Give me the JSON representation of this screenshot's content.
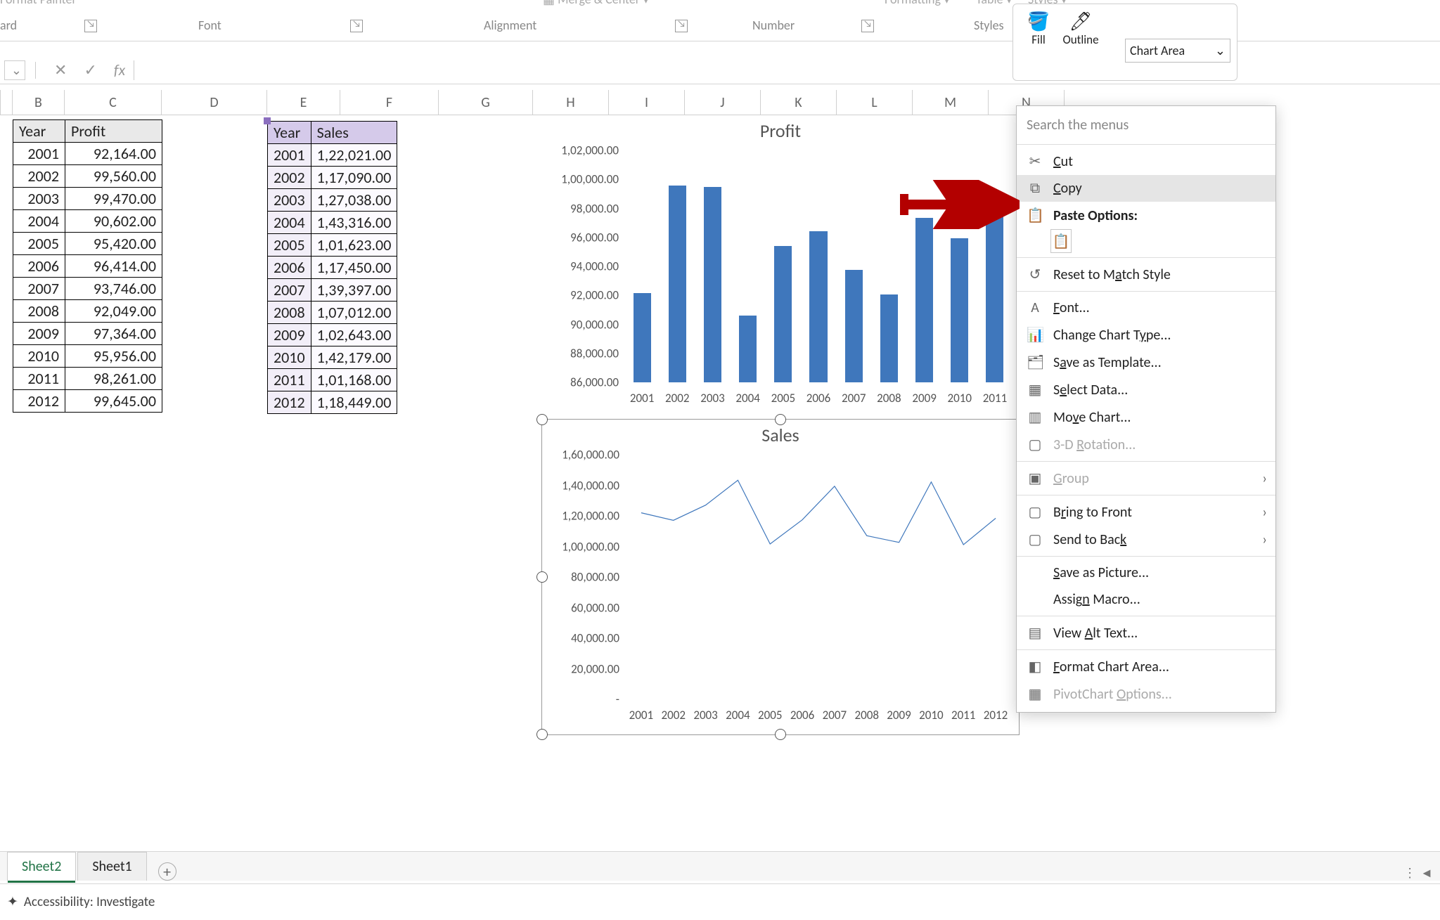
{
  "ribbon": {
    "format_painter": "Format Painter",
    "group_clipboard": "Clipboard",
    "group_font": "Font",
    "group_alignment": "Alignment",
    "group_number": "Number",
    "group_styles": "Styles",
    "merge_center": "Merge & Center",
    "formatting": "Conditional Formatting",
    "as_table": "Format as Table",
    "cell_styles": "Cell Styles",
    "fill": "Fill",
    "outline": "Outline",
    "chart_area": "Chart Area"
  },
  "formula_bar": {
    "fx": "fx"
  },
  "columns": [
    "",
    "B",
    "C",
    "D",
    "E",
    "F",
    "G",
    "H",
    "I",
    "J",
    "K",
    "L",
    "M",
    "N"
  ],
  "profit_table": {
    "headers": [
      "Year",
      "Profit"
    ],
    "rows": [
      [
        "2001",
        "92,164.00"
      ],
      [
        "2002",
        "99,560.00"
      ],
      [
        "2003",
        "99,470.00"
      ],
      [
        "2004",
        "90,602.00"
      ],
      [
        "2005",
        "95,420.00"
      ],
      [
        "2006",
        "96,414.00"
      ],
      [
        "2007",
        "93,746.00"
      ],
      [
        "2008",
        "92,049.00"
      ],
      [
        "2009",
        "97,364.00"
      ],
      [
        "2010",
        "95,956.00"
      ],
      [
        "2011",
        "98,261.00"
      ],
      [
        "2012",
        "99,645.00"
      ]
    ]
  },
  "sales_table": {
    "headers": [
      "Year",
      "Sales"
    ],
    "rows": [
      [
        "2001",
        "1,22,021.00"
      ],
      [
        "2002",
        "1,17,090.00"
      ],
      [
        "2003",
        "1,27,038.00"
      ],
      [
        "2004",
        "1,43,316.00"
      ],
      [
        "2005",
        "1,01,623.00"
      ],
      [
        "2006",
        "1,17,450.00"
      ],
      [
        "2007",
        "1,39,397.00"
      ],
      [
        "2008",
        "1,07,012.00"
      ],
      [
        "2009",
        "1,02,643.00"
      ],
      [
        "2010",
        "1,42,179.00"
      ],
      [
        "2011",
        "1,01,168.00"
      ],
      [
        "2012",
        "1,18,449.00"
      ]
    ]
  },
  "chart_data": [
    {
      "type": "bar",
      "title": "Profit",
      "categories": [
        "2001",
        "2002",
        "2003",
        "2004",
        "2005",
        "2006",
        "2007",
        "2008",
        "2009",
        "2010",
        "2011"
      ],
      "values": [
        92164,
        99560,
        99470,
        90602,
        95420,
        96414,
        93746,
        92049,
        97364,
        95956,
        98261
      ],
      "ylim": [
        86000,
        102000
      ],
      "yticks": [
        "1,02,000.00",
        "1,00,000.00",
        "98,000.00",
        "96,000.00",
        "94,000.00",
        "92,000.00",
        "90,000.00",
        "88,000.00",
        "86,000.00"
      ],
      "xlabel": "",
      "ylabel": ""
    },
    {
      "type": "line",
      "title": "Sales",
      "categories": [
        "2001",
        "2002",
        "2003",
        "2004",
        "2005",
        "2006",
        "2007",
        "2008",
        "2009",
        "2010",
        "2011",
        "2012"
      ],
      "values": [
        122021,
        117090,
        127038,
        143316,
        101623,
        117450,
        139397,
        107012,
        102643,
        142179,
        101168,
        118449
      ],
      "ylim": [
        0,
        160000
      ],
      "yticks": [
        "1,60,000.00",
        "1,40,000.00",
        "1,20,000.00",
        "1,00,000.00",
        "80,000.00",
        "60,000.00",
        "40,000.00",
        "20,000.00",
        "-"
      ],
      "xlabel": "",
      "ylabel": ""
    }
  ],
  "context_menu": {
    "search_placeholder": "Search the menus",
    "cut": "Cut",
    "copy": "Copy",
    "paste_options": "Paste Options:",
    "reset": "Reset to Match Style",
    "font": "Font...",
    "change_type": "Change Chart Type...",
    "save_template": "Save as Template...",
    "select_data": "Select Data...",
    "move_chart": "Move Chart...",
    "rotation": "3-D Rotation...",
    "group": "Group",
    "bring_front": "Bring to Front",
    "send_back": "Send to Back",
    "save_picture": "Save as Picture...",
    "assign_macro": "Assign Macro...",
    "alt_text": "View Alt Text...",
    "format_area": "Format Chart Area...",
    "pivot_options": "PivotChart Options..."
  },
  "tabs": {
    "sheet2": "Sheet2",
    "sheet1": "Sheet1"
  },
  "status": {
    "accessibility": "Accessibility: Investigate"
  }
}
